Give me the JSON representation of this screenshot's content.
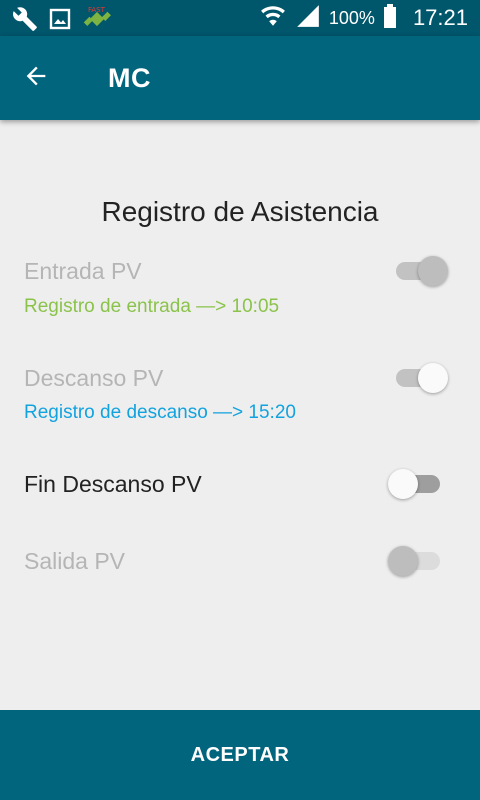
{
  "status_bar": {
    "battery": "100%",
    "time": "17:21",
    "icons": [
      "wrench-icon",
      "image-icon",
      "satellite-app-icon",
      "wifi-icon",
      "signal-icon",
      "battery-icon"
    ]
  },
  "app_bar": {
    "title": "MC",
    "back_icon": "arrow-left-icon"
  },
  "main": {
    "section_title": "Registro de Asistencia",
    "rows": [
      {
        "label": "Entrada PV",
        "state": "on",
        "enabled": false,
        "status": "Registro de entrada —> 10:05",
        "status_color": "#8bc34a"
      },
      {
        "label": "Descanso PV",
        "state": "on",
        "enabled": false,
        "status": "Registro de descanso —> 15:20",
        "status_color": "#12a3df"
      },
      {
        "label": "Fin Descanso PV",
        "state": "off",
        "enabled": true
      },
      {
        "label": "Salida PV",
        "state": "off",
        "enabled": false
      }
    ]
  },
  "footer": {
    "accept_label": "ACEPTAR"
  },
  "colors": {
    "status_bar_bg": "#00566b",
    "app_bar_bg": "#01657e",
    "page_bg": "#eeeeee",
    "entry_status": "#8bc34a",
    "break_status": "#12a3df"
  }
}
